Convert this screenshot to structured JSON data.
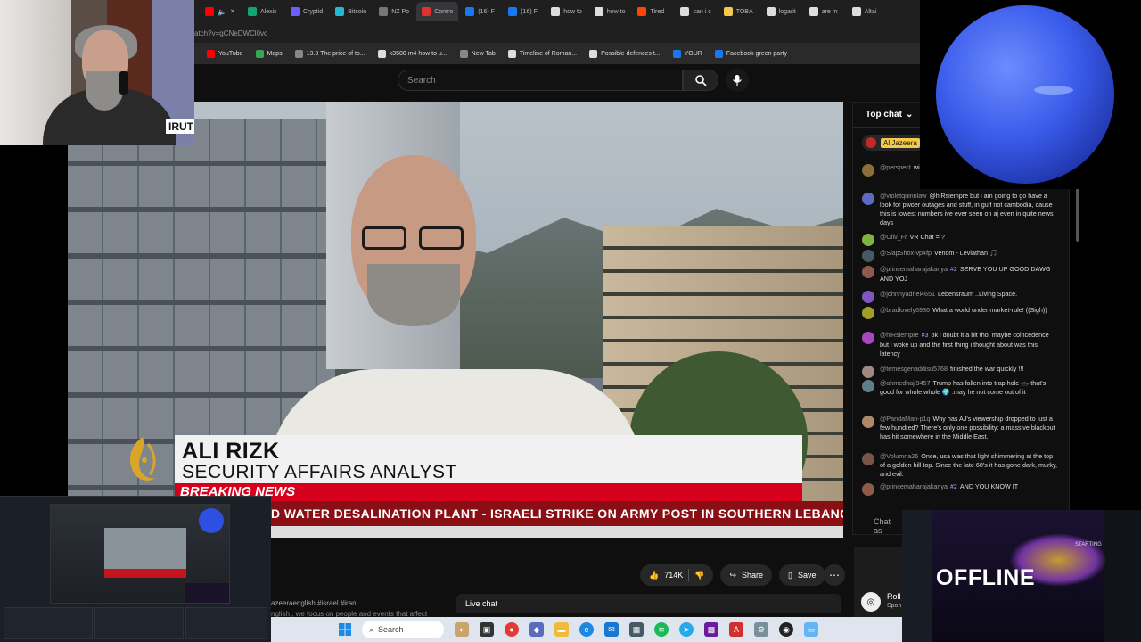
{
  "browser": {
    "tabs": [
      {
        "label": "Alexis",
        "color": "#0ca678"
      },
      {
        "label": "Cryptid",
        "color": "#6d5dfc"
      },
      {
        "label": "Bitcoin",
        "color": "#1fbad6"
      },
      {
        "label": "NZ Po",
        "color": "#777777"
      },
      {
        "label": "Contro",
        "color": "#e03131"
      },
      {
        "label": "(16) F",
        "color": "#1877f2"
      },
      {
        "label": "(16) F",
        "color": "#1877f2"
      },
      {
        "label": "how to",
        "color": "#dddddd"
      },
      {
        "label": "how to",
        "color": "#dddddd"
      },
      {
        "label": "Tired",
        "color": "#ff4500"
      },
      {
        "label": "can i c",
        "color": "#dddddd"
      },
      {
        "label": "TOBA",
        "color": "#f2c94c"
      },
      {
        "label": "logarit",
        "color": "#dddddd"
      },
      {
        "label": "are m",
        "color": "#dddddd"
      },
      {
        "label": "Altai",
        "color": "#dddddd"
      }
    ],
    "url": "atch?v=gCNeDWCl0vo",
    "bookmarks": [
      {
        "label": "YouTube",
        "color": "#ff0000"
      },
      {
        "label": "Maps",
        "color": "#34a853"
      },
      {
        "label": "13.3 The price of to...",
        "color": "#888888"
      },
      {
        "label": "x3500 m4 how to u...",
        "color": "#dddddd"
      },
      {
        "label": "New Tab",
        "color": "#888888"
      },
      {
        "label": "Timeline of Roman...",
        "color": "#dddddd"
      },
      {
        "label": "Possible defences t...",
        "color": "#dddddd"
      },
      {
        "label": "YOUR",
        "color": "#1877f2"
      },
      {
        "label": "Facebook green party",
        "color": "#1877f2"
      }
    ]
  },
  "youtube": {
    "search_placeholder": "Search",
    "video": {
      "name": "ALI RIZK",
      "role": "SECURITY AFFAIRS ANALYST",
      "breaking": "BREAKING NEWS",
      "ticker": "D WATER DESALINATION PLANT   -   ISRAELI STRIKE ON ARMY POST IN SOUTHERN LEBANON",
      "location_tag": "IRUT"
    },
    "likes": "714K",
    "share_label": "Share",
    "save_label": "Save",
    "description_line1": "azeeraenglish #israel #iran",
    "description_line2": "nglish , we focus on people and events that affect",
    "live_chat_tab": "Live chat"
  },
  "chat": {
    "header": "Top chat",
    "pinned_label": "Al Jazeera",
    "messages": [
      {
        "author": "@perspect",
        "badge": "",
        "text": "will start u flowing",
        "color": "#8a6d3b"
      },
      {
        "author": "@violetquinnlaw",
        "badge": "",
        "text": "@hlRsiempre but i am going to go have a look for pwoer outages and stuff, in gulf not cambodia, cause this is lowest numbers ive ever seen on aj even in quite news days",
        "color": "#5c6bc0"
      },
      {
        "author": "@Oliv_Fr",
        "badge": "",
        "text": "VR Chat = ?",
        "color": "#7cb342"
      },
      {
        "author": "@SlapShox-vp4fp",
        "badge": "",
        "text": "Venom - Leviathan 🎵",
        "color": "#455a64"
      },
      {
        "author": "@princemaharajakanya",
        "badge": "#2",
        "text": "SERVE YOU UP GOOD DAWG AND YOJ",
        "color": "#8e5b4a"
      },
      {
        "author": "@johnnyadriel4651",
        "badge": "",
        "text": "Lebensraum ..Living Space.",
        "color": "#7e57c2"
      },
      {
        "author": "@bradlovely6936",
        "badge": "",
        "text": "What a world under market-rule! ((Sigh))",
        "color": "#9e9d24"
      },
      {
        "author": "@hlRsiempre",
        "badge": "#3",
        "text": "ok i doubt it a bit tho. maybe coincedence but i woke up and the first thing i thought about was this latency",
        "color": "#ab47bc"
      },
      {
        "author": "@temesgenaddisu5768",
        "badge": "",
        "text": "finished the war quickly !!!",
        "color": "#a1887f"
      },
      {
        "author": "@ahmedhaji9457",
        "badge": "",
        "text": "Trump has fallen into trap hole 🕳️ that's good for whole whole 🌍 .may he not come out of it",
        "color": "#607d8b"
      },
      {
        "author": "@PandaMan-p1q",
        "badge": "",
        "text": "Why has AJ's viewership dropped to just a few hundred? There's only one possibility: a massive blackout has hit somewhere in the Middle East.",
        "color": "#b08968"
      },
      {
        "author": "@Volumna26",
        "badge": "",
        "text": "Once, usa was that light shimmering at the top of a golden hill top. Since the late 60's it has gone dark, murky, and evil.",
        "color": "#795548"
      },
      {
        "author": "@princemaharajakanya",
        "badge": "#2",
        "text": "AND YOU KNOW IT",
        "color": "#8e5b4a"
      }
    ],
    "input_placeholder": "Chat as",
    "ad_title": "Roll",
    "ad_sub": "Spon"
  },
  "overlay": {
    "offline_text": "OFFLINE",
    "starting_text": "STARTING"
  },
  "taskbar": {
    "search_label": "Search"
  }
}
